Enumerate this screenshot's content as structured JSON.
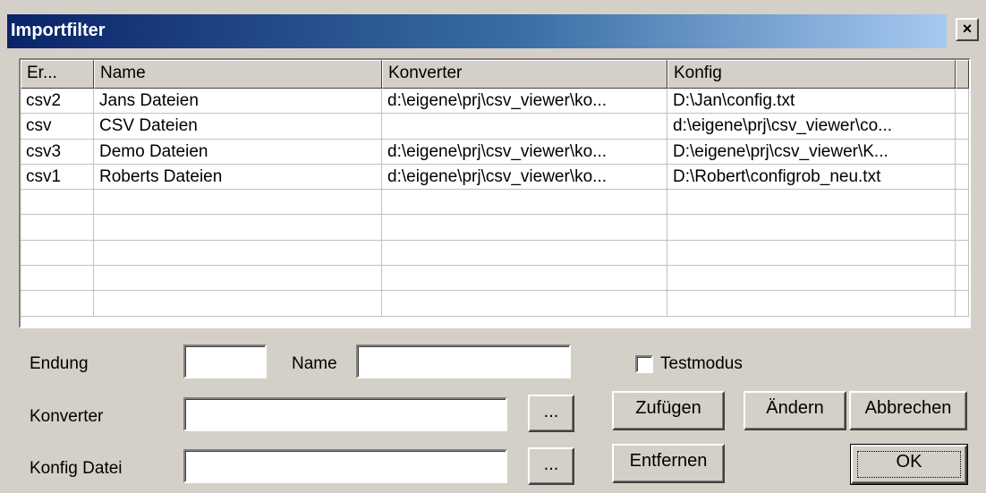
{
  "window": {
    "title": "Importfilter",
    "close_glyph": "×"
  },
  "table": {
    "columns": [
      "Er...",
      "Name",
      "Konverter",
      "Konfig"
    ],
    "rows": [
      [
        "csv2",
        "Jans Dateien",
        "d:\\eigene\\prj\\csv_viewer\\ko...",
        "D:\\Jan\\config.txt"
      ],
      [
        "csv",
        "CSV Dateien",
        "",
        "d:\\eigene\\prj\\csv_viewer\\co..."
      ],
      [
        "csv3",
        "Demo Dateien",
        "d:\\eigene\\prj\\csv_viewer\\ko...",
        "D:\\eigene\\prj\\csv_viewer\\K..."
      ],
      [
        "csv1",
        "Roberts Dateien",
        "d:\\eigene\\prj\\csv_viewer\\ko...",
        "D:\\Robert\\configrob_neu.txt"
      ],
      [
        "",
        "",
        "",
        ""
      ],
      [
        "",
        "",
        "",
        ""
      ],
      [
        "",
        "",
        "",
        ""
      ],
      [
        "",
        "",
        "",
        ""
      ],
      [
        "",
        "",
        "",
        ""
      ]
    ]
  },
  "form": {
    "endung_label": "Endung",
    "endung_value": "",
    "name_label": "Name",
    "name_value": "",
    "testmodus_label": "Testmodus",
    "testmodus_checked": false,
    "konverter_label": "Konverter",
    "konverter_value": "",
    "konfig_label": "Konfig Datei",
    "konfig_value": ""
  },
  "buttons": {
    "browse_konverter": "...",
    "browse_konfig": "...",
    "zufuegen": "Zufügen",
    "aendern": "Ändern",
    "abbrechen": "Abbrechen",
    "entfernen": "Entfernen",
    "ok": "OK"
  }
}
